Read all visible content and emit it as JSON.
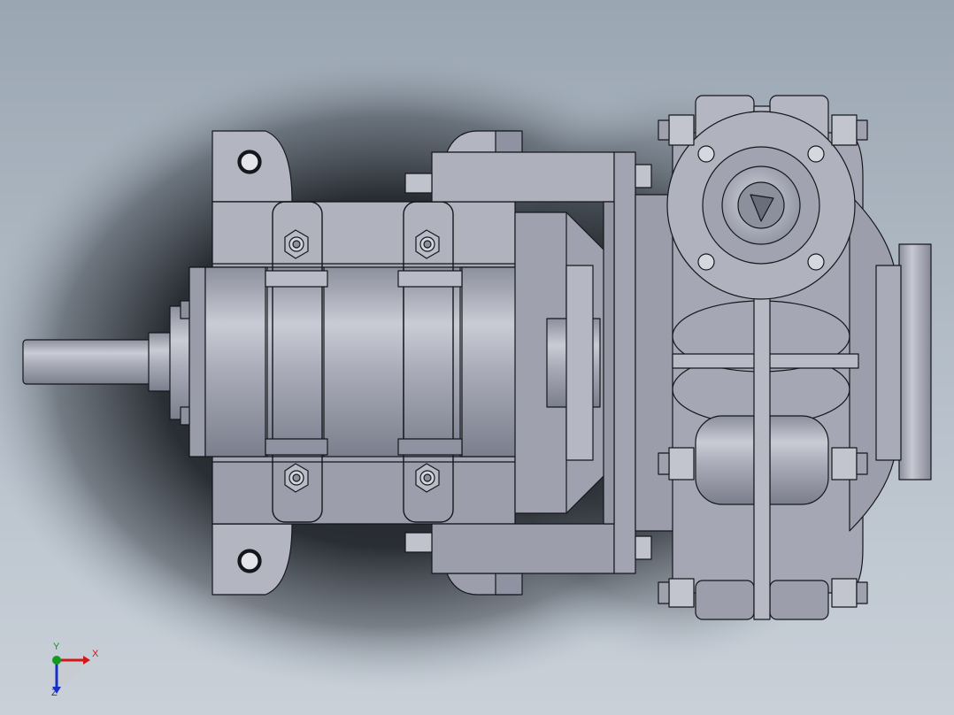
{
  "viewport": {
    "background_top": "#9aa6b2",
    "background_bottom": "#c9d0d8",
    "shadow_color": "#1a1d22",
    "part_fill": "#a7a9b6",
    "part_dark": "#7e8190",
    "part_light": "#c8cad4",
    "edge_color": "#16171c"
  },
  "triad": {
    "x_label": "X",
    "y_label": "Y",
    "z_label": "Z",
    "x_color": "#d01818",
    "y_color": "#109a20",
    "z_color": "#1830c8"
  }
}
